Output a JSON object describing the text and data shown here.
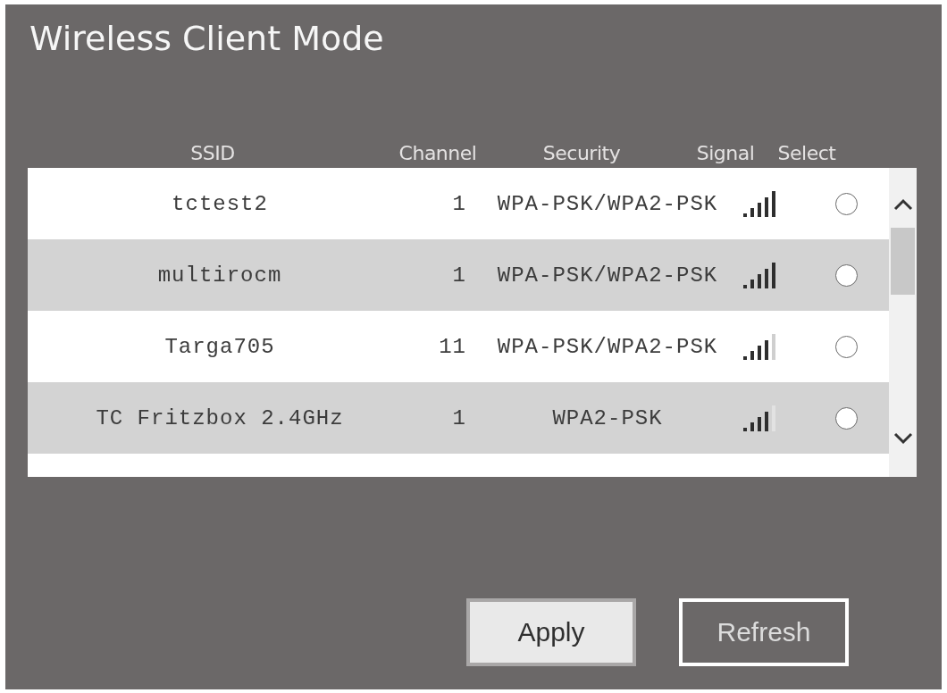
{
  "window": {
    "title": "Wireless Client Mode"
  },
  "table": {
    "columns": [
      "SSID",
      "Channel",
      "Security",
      "Signal",
      "Select"
    ],
    "rows": [
      {
        "ssid": "tctest2",
        "channel": "1",
        "security": "WPA-PSK/WPA2-PSK",
        "signal_full": true,
        "selected": false
      },
      {
        "ssid": "multirocm",
        "channel": "1",
        "security": "WPA-PSK/WPA2-PSK",
        "signal_full": true,
        "selected": false
      },
      {
        "ssid": "Targa705",
        "channel": "11",
        "security": "WPA-PSK/WPA2-PSK",
        "signal_full": false,
        "selected": false
      },
      {
        "ssid": "TC Fritzbox 2.4GHz",
        "channel": "1",
        "security": "WPA2-PSK",
        "signal_full": false,
        "selected": false
      }
    ]
  },
  "buttons": [
    {
      "label": "Apply",
      "kind": "filled"
    },
    {
      "label": "Refresh",
      "kind": "outline"
    }
  ]
}
